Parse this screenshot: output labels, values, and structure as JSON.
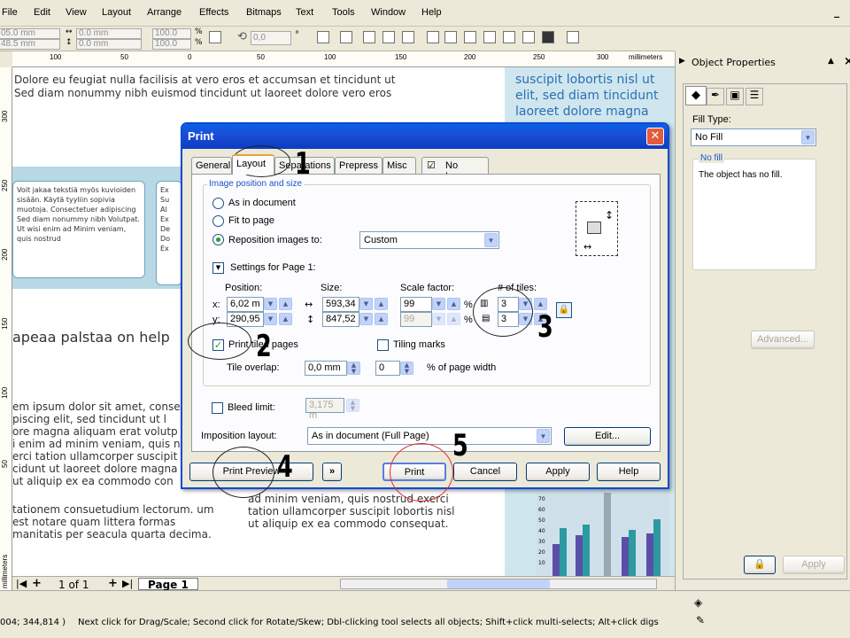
{
  "menu": [
    "File",
    "Edit",
    "View",
    "Layout",
    "Arrange",
    "Effects",
    "Bitmaps",
    "Text",
    "Tools",
    "Window",
    "Help"
  ],
  "propbar": {
    "x_val": "05.0 mm",
    "y_val": "48.5 mm",
    "w_val": "0.0 mm",
    "h_val": "0.0 mm",
    "sx": "100.0",
    "sy": "100.0",
    "pct": "%",
    "rotate": "0,0",
    "deg": "°"
  },
  "ruler": {
    "h_ticks": [
      "100",
      "50",
      "0",
      "50",
      "100",
      "150",
      "200",
      "250",
      "300"
    ],
    "unit": "millimeters",
    "v_ticks": [
      "300",
      "250",
      "200",
      "150",
      "100",
      "50"
    ],
    "v_unit": "millimeters"
  },
  "document": {
    "top_text_1": "Dolore eu feugiat nulla facilisis at vero eros et accumsan et tincidunt ut",
    "top_text_2": "Sed diam nonummy nibh euismod tincidunt ut laoreet dolore vero eros",
    "blue_text": "suscipit lobortis nisl ut elit, sed diam tincidunt laoreet dolore magna",
    "card1": "Voit jakaa tekstiä myös kuvioiden sisään. Käytä tyyliin sopivia muotoja. Consectetuer adipiscing Sed diam nonummy nibh Volutpat. Ut wisi enim ad Minim veniam, quis nostrud",
    "card2": "Ex Su Al Ex De Do Ex",
    "heading": "apeaa palstaa on help",
    "left_para": "em ipsum dolor sit amet, conse piscing elit, sed tincidunt ut l ore magna aliquam erat volutp i enim ad minim veniam, quis n erci tation ullamcorper suscipit cidunt ut laoreet dolore magna ut aliquip ex ea commodo con",
    "left_para2": "tationem consuetudium lectorum. um est notare quam littera formas manitatis per seacula quarta decima.",
    "mid_para": "ad minim veniam, quis nostrud exerci tation ullamcorper suscipit lobortis nisl ut aliquip ex ea commodo consequat.",
    "chart_ticks": [
      "70",
      "60",
      "50",
      "40",
      "30",
      "20",
      "10"
    ]
  },
  "pagebar": {
    "page_of": "1 of 1",
    "page_tab": "Page 1"
  },
  "status": {
    "coords": "004; 344,814 )",
    "hint": "Next click for Drag/Scale; Second click for Rotate/Skew; Dbl-clicking tool selects all objects; Shift+click multi-selects; Alt+click digs"
  },
  "docker": {
    "title": "Object Properties",
    "fill_type_label": "Fill Type:",
    "fill_type_value": "No Fill",
    "no_fill_legend": "No fill",
    "no_fill_text": "The object has no fill.",
    "advanced": "Advanced...",
    "apply": "Apply"
  },
  "dialog": {
    "title": "Print",
    "tabs": [
      "General",
      "Layout",
      "Separations",
      "Prepress",
      "Misc",
      "No Issues"
    ],
    "group_title": "Image position and size",
    "radio_as_doc": "As in document",
    "radio_fit": "Fit to page",
    "radio_reposition": "Reposition images to:",
    "reposition_value": "Custom",
    "settings_label": "Settings for Page 1:",
    "position_label": "Position:",
    "size_label": "Size:",
    "scale_label": "Scale factor:",
    "tiles_label": "# of tiles:",
    "x_label": "x:",
    "y_label": "y:",
    "pos_x": "6,02 m",
    "pos_y": "290,95",
    "size_w": "593,34",
    "size_h": "847,52",
    "scale_x": "99",
    "scale_y": "99",
    "pct": "%",
    "tiles_x": "3",
    "tiles_y": "3",
    "print_tiled": "Print tiled pages",
    "tiling_marks": "Tiling marks",
    "tile_overlap_label": "Tile overlap:",
    "tile_overlap_val": "0,0 mm",
    "tile_pct_val": "0",
    "pct_page_width": "% of page width",
    "bleed_label": "Bleed limit:",
    "bleed_val": "3,175 m",
    "imposition_label": "Imposition layout:",
    "imposition_val": "As in document (Full Page)",
    "edit_btn": "Edit...",
    "print_preview": "Print Preview",
    "forward": "»",
    "print": "Print",
    "cancel": "Cancel",
    "apply": "Apply",
    "help": "Help"
  },
  "annotations": [
    "1",
    "2",
    "3",
    "4",
    "5"
  ]
}
